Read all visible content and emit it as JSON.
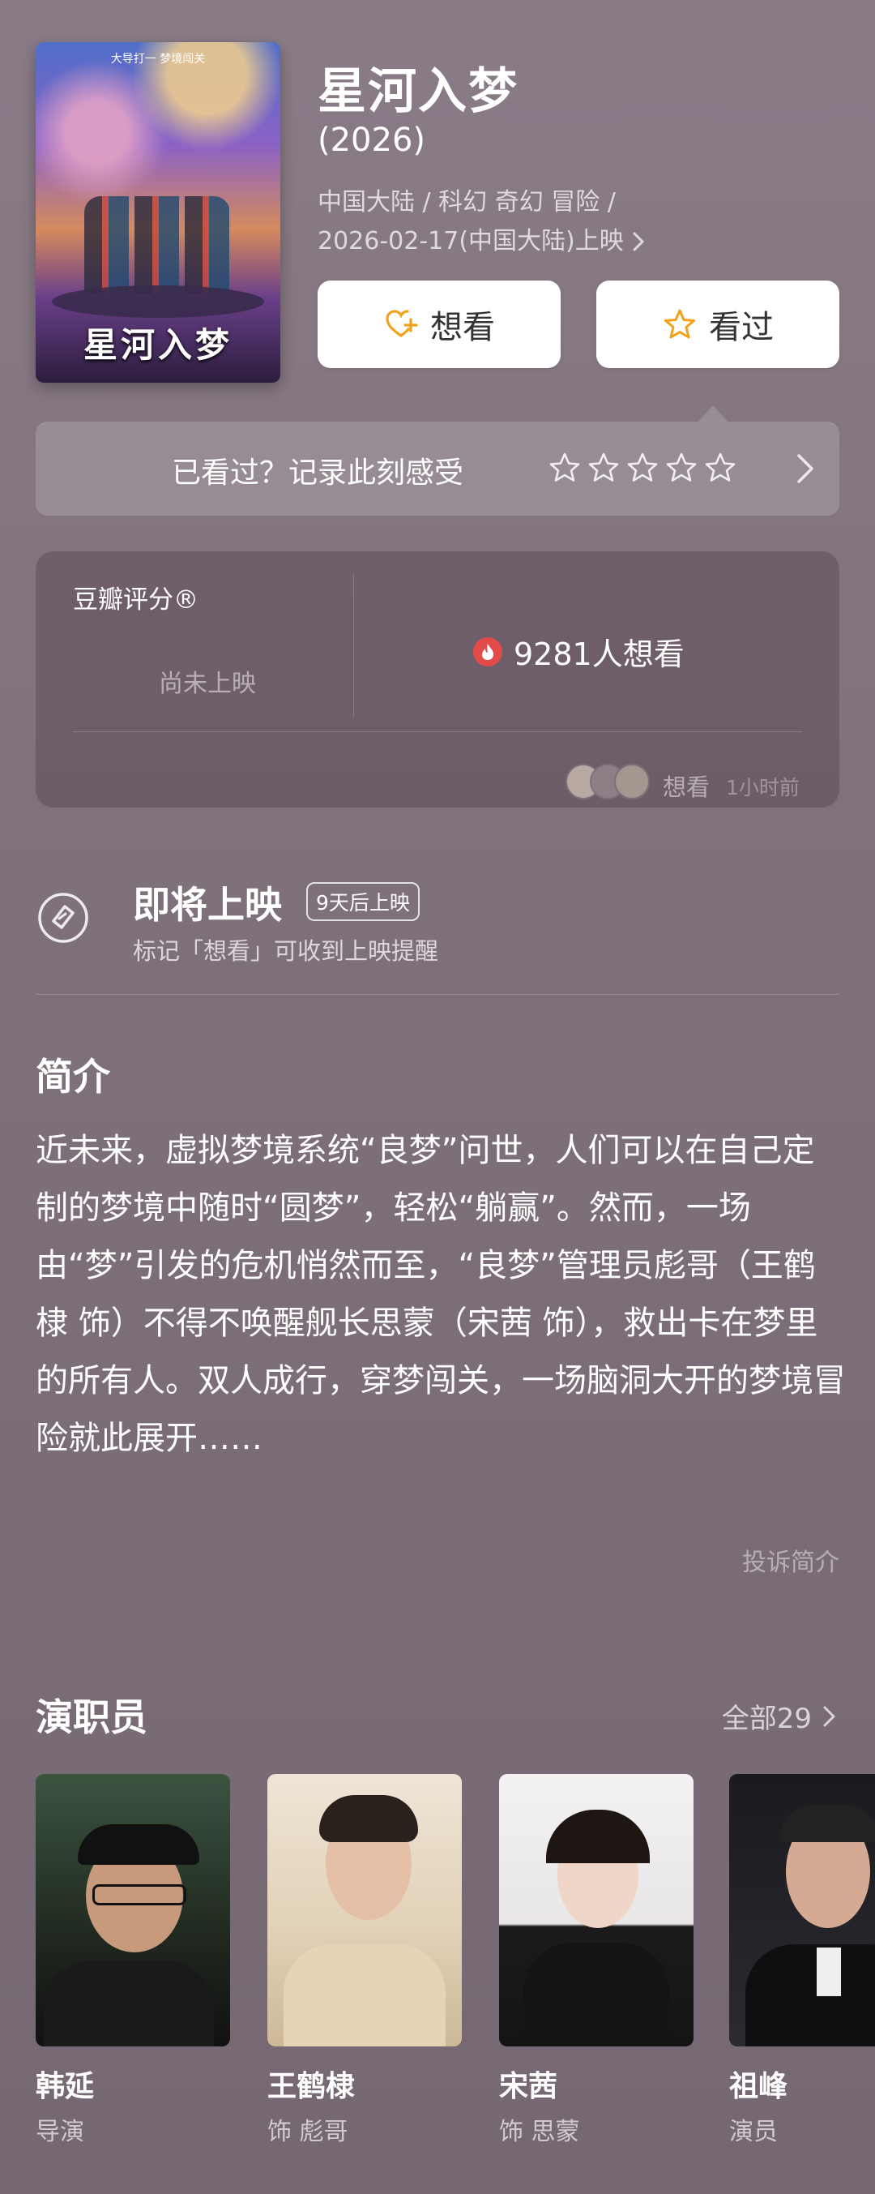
{
  "movie": {
    "title": "星河入梦",
    "year": "(2026)",
    "meta_line1": "中国大陆 / 科幻 奇幻 冒险 /",
    "meta_line2": "2026-02-17(中国大陆)上映",
    "poster": {
      "top_text": "大导打一 梦境闯关",
      "title_text": "星河入梦"
    }
  },
  "actions": {
    "want_label": "想看",
    "seen_label": "看过"
  },
  "record_bar": {
    "label": "已看过？记录此刻感受",
    "stars_filled": 0,
    "stars_total": 5
  },
  "score": {
    "brand": "豆瓣评分®",
    "status": "尚未上映",
    "want_count": "9281人想看",
    "recent_label": "想看",
    "recent_time": "1小时前"
  },
  "release": {
    "title": "即将上映",
    "badge": "9天后上映",
    "subtitle": "标记「想看」可收到上映提醒"
  },
  "intro": {
    "heading": "简介",
    "text": "近未来，虚拟梦境系统“良梦”问世，人们可以在自己定制的梦境中随时“圆梦”，轻松“躺赢”。然而，一场由“梦”引发的危机悄然而至，“良梦”管理员彪哥（王鹤棣 饰）不得不唤醒舰长思蒙（宋茜 饰），救出卡在梦里的所有人。双人成行，穿梦闯关，一场脑洞大开的梦境冒险就此展开……",
    "complain": "投诉简介"
  },
  "cast": {
    "heading": "演职员",
    "all_label": "全部29",
    "members": [
      {
        "name": "韩延",
        "role": "导演"
      },
      {
        "name": "王鹤棣",
        "role": "饰 彪哥"
      },
      {
        "name": "宋茜",
        "role": "饰 思蒙"
      },
      {
        "name": "祖峰",
        "role": "演员"
      }
    ]
  },
  "colors": {
    "background": "#7f717b",
    "accent_yellow": "#f0a21b",
    "flame_red": "#e34b4b"
  }
}
